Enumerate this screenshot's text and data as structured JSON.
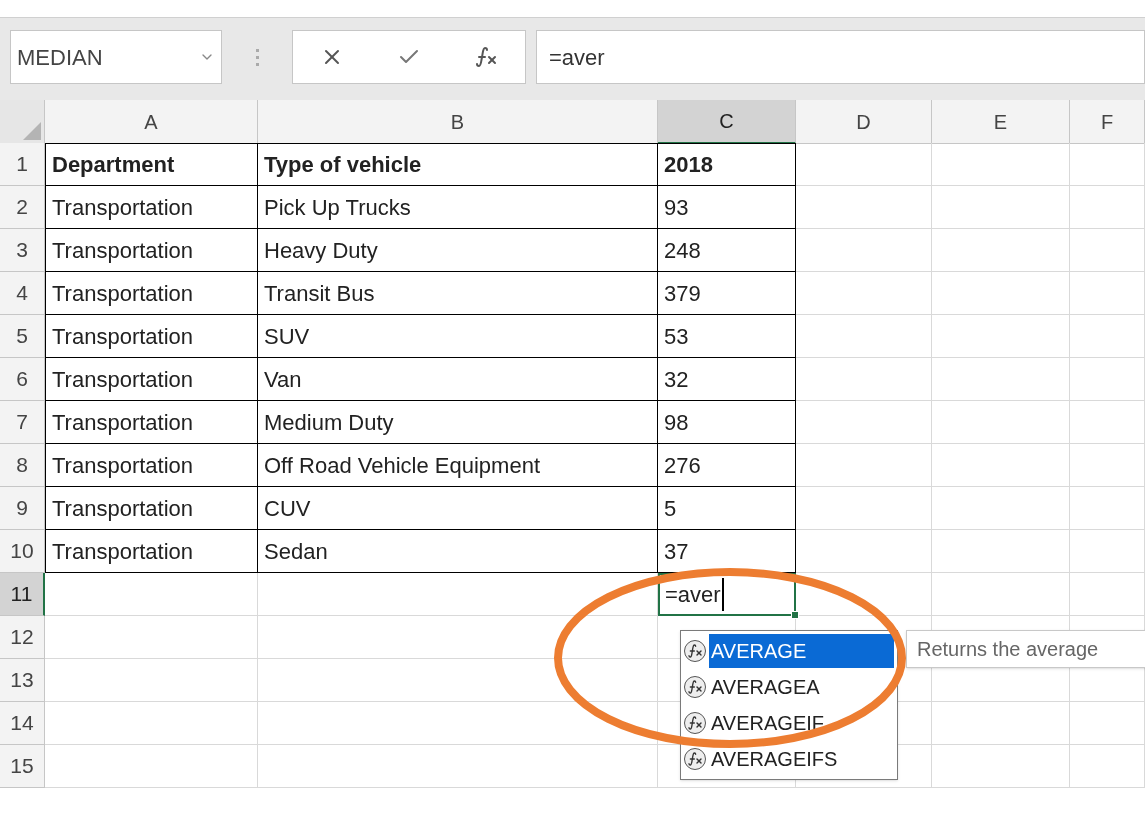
{
  "name_box": {
    "value": "MEDIAN"
  },
  "formula_bar": {
    "value": "=aver"
  },
  "columns": [
    {
      "label": "A",
      "selected": false
    },
    {
      "label": "B",
      "selected": false
    },
    {
      "label": "C",
      "selected": true
    },
    {
      "label": "D",
      "selected": false
    },
    {
      "label": "E",
      "selected": false
    },
    {
      "label": "F",
      "selected": false
    }
  ],
  "rows": [
    {
      "number": "1",
      "selected": false,
      "kind": "header",
      "cells": [
        "Department",
        "Type of vehicle",
        "2018"
      ]
    },
    {
      "number": "2",
      "selected": false,
      "kind": "data",
      "cells": [
        "Transportation",
        "Pick Up Trucks",
        "93"
      ]
    },
    {
      "number": "3",
      "selected": false,
      "kind": "data",
      "cells": [
        "Transportation",
        "Heavy Duty",
        "248"
      ]
    },
    {
      "number": "4",
      "selected": false,
      "kind": "data",
      "cells": [
        "Transportation",
        "Transit Bus",
        "379"
      ]
    },
    {
      "number": "5",
      "selected": false,
      "kind": "data",
      "cells": [
        "Transportation",
        "SUV",
        "53"
      ]
    },
    {
      "number": "6",
      "selected": false,
      "kind": "data",
      "cells": [
        "Transportation",
        "Van",
        "32"
      ]
    },
    {
      "number": "7",
      "selected": false,
      "kind": "data",
      "cells": [
        "Transportation",
        "Medium Duty",
        "98"
      ]
    },
    {
      "number": "8",
      "selected": false,
      "kind": "data",
      "cells": [
        "Transportation",
        "Off Road Vehicle Equipment",
        "276"
      ]
    },
    {
      "number": "9",
      "selected": false,
      "kind": "data",
      "cells": [
        "Transportation",
        "CUV",
        "5"
      ]
    },
    {
      "number": "10",
      "selected": false,
      "kind": "data",
      "cells": [
        "Transportation",
        "Sedan",
        "37"
      ]
    },
    {
      "number": "11",
      "selected": true,
      "kind": "editing",
      "cells": [
        "=aver"
      ]
    },
    {
      "number": "12",
      "selected": false,
      "kind": "blank"
    },
    {
      "number": "13",
      "selected": false,
      "kind": "blank"
    },
    {
      "number": "14",
      "selected": false,
      "kind": "blank"
    },
    {
      "number": "15",
      "selected": false,
      "kind": "blank"
    }
  ],
  "autocomplete": {
    "items": [
      {
        "label": "AVERAGE",
        "selected": true
      },
      {
        "label": "AVERAGEA",
        "selected": false
      },
      {
        "label": "AVERAGEIF",
        "selected": false
      },
      {
        "label": "AVERAGEIFS",
        "selected": false
      }
    ],
    "tooltip": "Returns the average"
  }
}
